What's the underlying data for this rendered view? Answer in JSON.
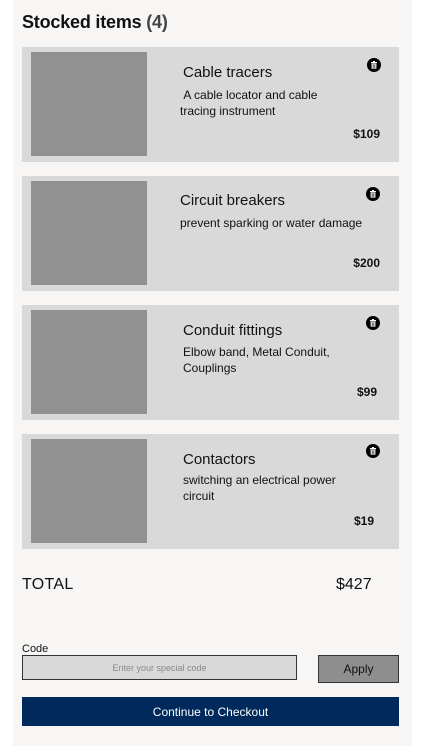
{
  "cart": {
    "title": "Stocked items",
    "count_display": "(4)",
    "items": [
      {
        "name": "Cable tracers",
        "description": " A cable locator and cable tracing instrument",
        "price": "$109"
      },
      {
        "name": "Circuit breakers",
        "description": "prevent sparking or water damage",
        "price": "$200"
      },
      {
        "name": "Conduit fittings",
        "description": "Elbow band, Metal Conduit, Couplings",
        "price": "$99"
      },
      {
        "name": "Contactors",
        "description": "switching an electrical power circuit",
        "price": "$19"
      }
    ],
    "item_icon": "trash-icon",
    "total_label": "TOTAL",
    "total_value": "$427"
  },
  "promo": {
    "label": "Code",
    "placeholder": "Enter your special code",
    "value": "",
    "apply_label": "Apply"
  },
  "checkout": {
    "label": "Continue to Checkout"
  },
  "colors": {
    "panel_bg": "#f7f6f4",
    "card_bg": "#d9d9d9",
    "thumbnail": "#919191",
    "checkout_bg": "#002a5c",
    "checkout_text": "#ffffff"
  }
}
